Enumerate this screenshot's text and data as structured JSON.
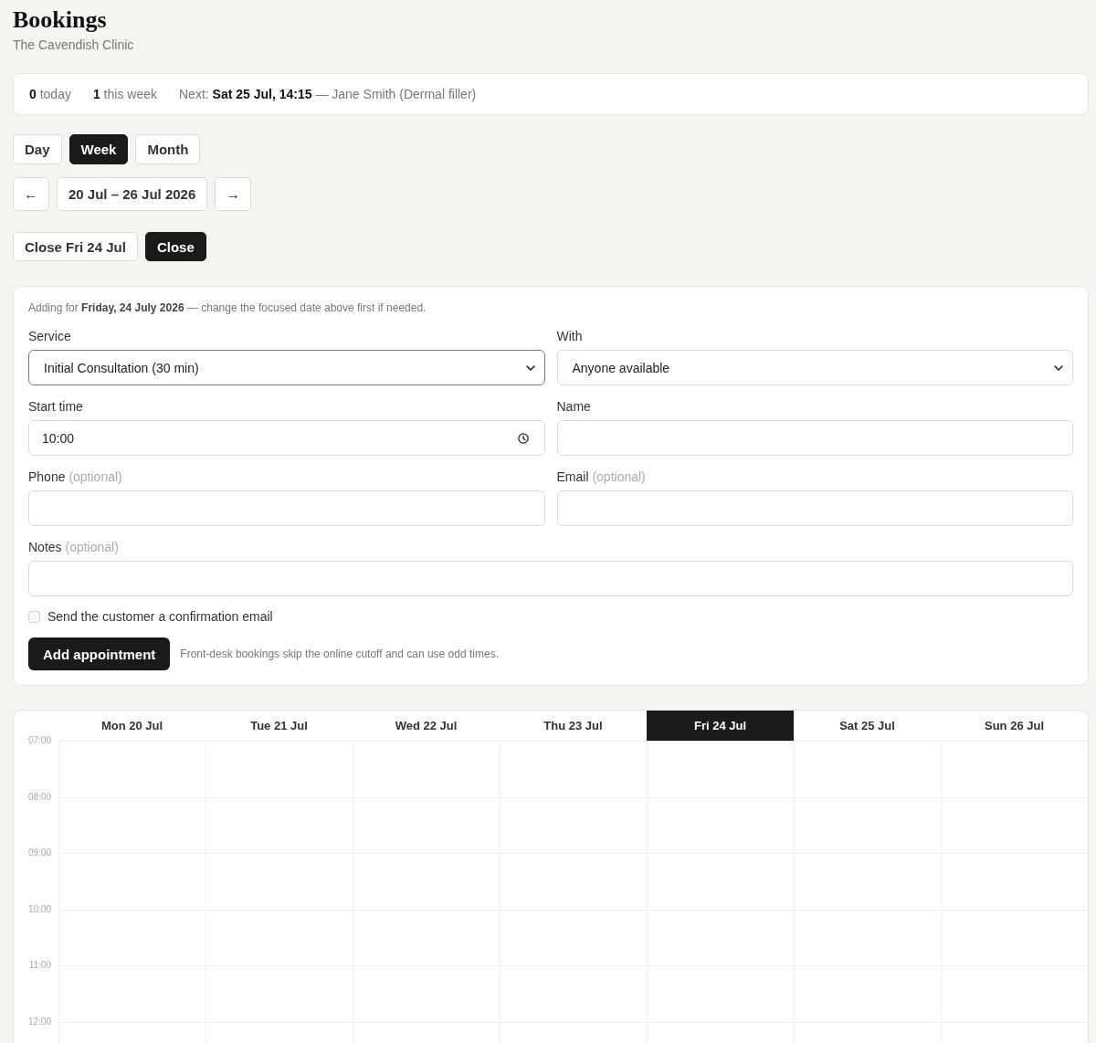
{
  "header": {
    "title": "Bookings",
    "subtitle": "The Cavendish Clinic"
  },
  "summary": [
    "**0** today",
    "**1** this week",
    "Next: **Sat 25 Jul, 14:15** — Jane Smith (Dermal filler)"
  ],
  "view_tabs": [
    {
      "label": "Day",
      "selected": false
    },
    {
      "label": "Week",
      "selected": true
    },
    {
      "label": "Month",
      "selected": false
    }
  ],
  "date_nav": {
    "previous": "←",
    "range": "20 Jul – 26 Jul 2026",
    "next": "→"
  },
  "day_actions": [
    {
      "label": "Close Fri 24 Jul",
      "kind": "secondary"
    },
    {
      "label": "Close",
      "kind": "primary"
    }
  ],
  "form": {
    "note": "Adding for **Friday, 24 July 2026** — change the focused date above first if needed.",
    "fields": [
      {
        "kind": "select",
        "label": "Service",
        "value": "Initial Consultation (30 min)",
        "focused": true
      },
      {
        "kind": "select",
        "label": "With",
        "value": "Anyone available",
        "focused": false
      },
      {
        "kind": "time",
        "label": "Start time",
        "value": "10:00",
        "focused": false
      },
      {
        "kind": "text",
        "label": "Name",
        "focused": false
      },
      {
        "kind": "text",
        "label": "Phone",
        "hint": "(optional)",
        "focused": false
      },
      {
        "kind": "text",
        "label": "Email",
        "hint": "(optional)",
        "focused": false
      }
    ],
    "notes": {
      "kind": "text",
      "label": "Notes",
      "hint": "(optional)",
      "focused": false
    },
    "confirm": {
      "label": "Send the customer a confirmation email",
      "checked": false
    },
    "submit": "Add appointment",
    "submit_hint": "Front-desk bookings skip the online cutoff and can use odd times."
  },
  "calendar": {
    "days": [
      {
        "label": "Mon 20 Jul",
        "selected": false
      },
      {
        "label": "Tue 21 Jul",
        "selected": false
      },
      {
        "label": "Wed 22 Jul",
        "selected": false
      },
      {
        "label": "Thu 23 Jul",
        "selected": false
      },
      {
        "label": "Fri 24 Jul",
        "selected": true
      },
      {
        "label": "Sat 25 Jul",
        "selected": false
      },
      {
        "label": "Sun 26 Jul",
        "selected": false
      }
    ],
    "hours": [
      "07:00",
      "08:00",
      "09:00",
      "10:00",
      "11:00",
      "12:00"
    ]
  }
}
